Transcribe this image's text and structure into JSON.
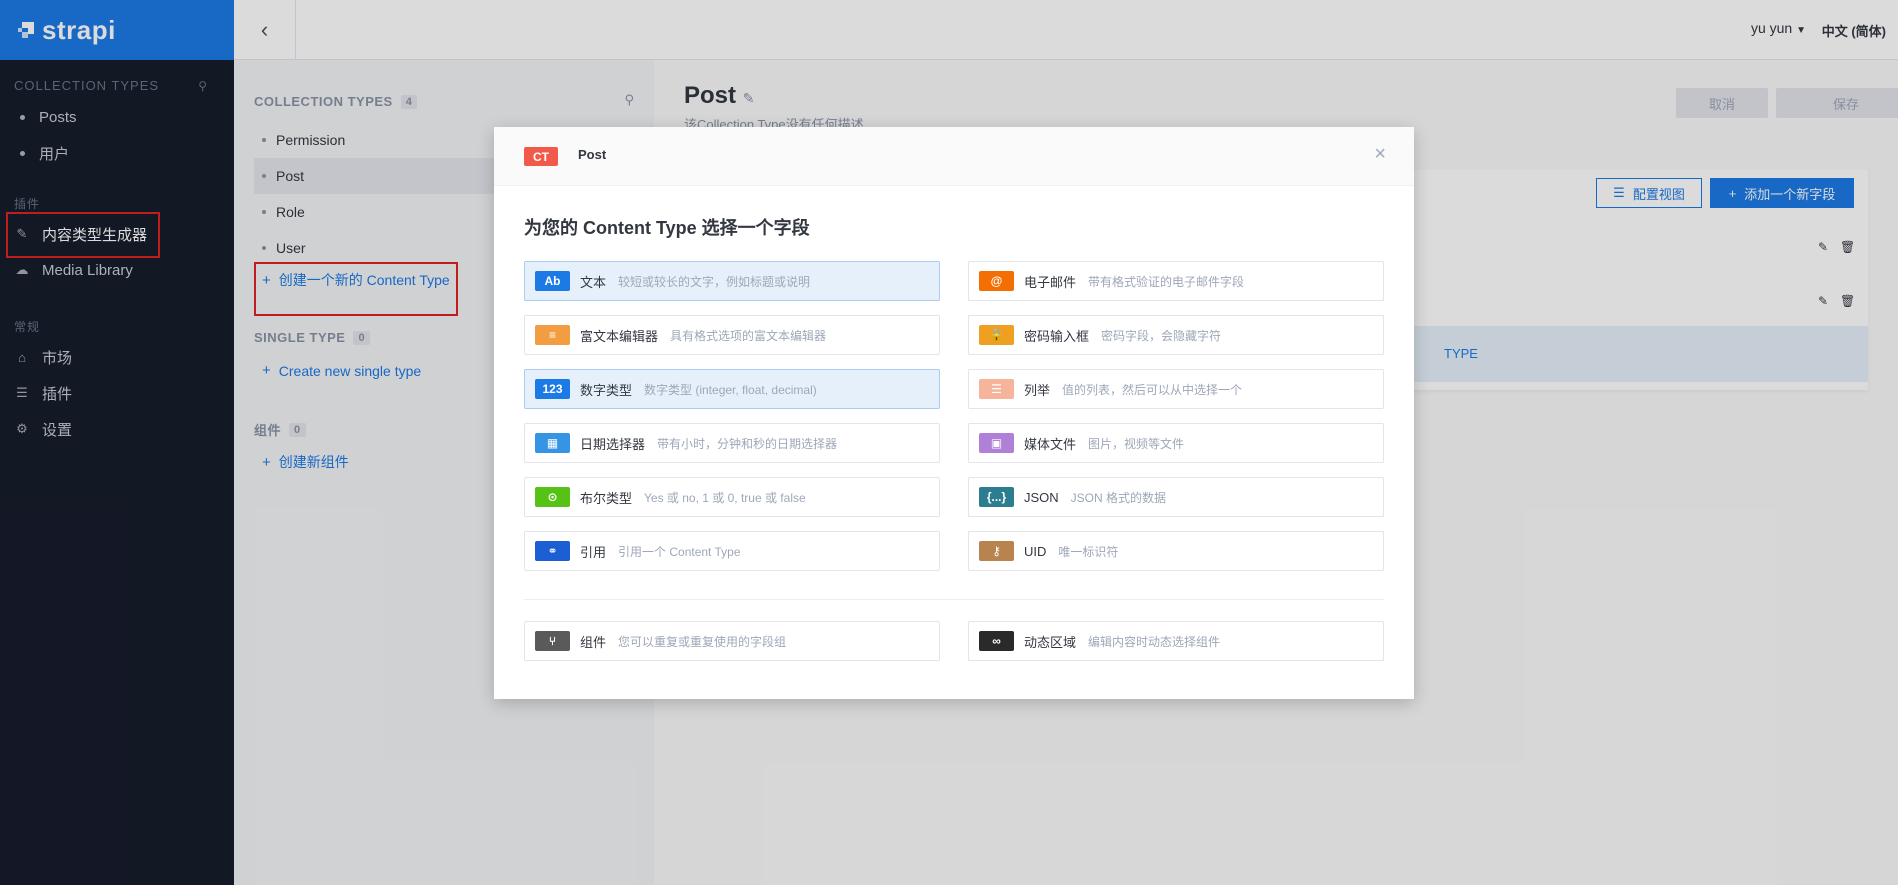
{
  "nav": {
    "brand": "strapi",
    "collection_types_label": "COLLECTION TYPES",
    "collection_items": [
      "Posts",
      "用户"
    ],
    "plugins_label": "插件",
    "plugin_items": [
      "内容类型生成器",
      "Media Library"
    ],
    "general_label": "常规",
    "general_items": [
      "市场",
      "插件",
      "设置"
    ]
  },
  "header": {
    "user": "yu yun",
    "language": "中文 (简体)"
  },
  "ct_list": {
    "collection_label": "COLLECTION TYPES",
    "collection_count": "4",
    "items": [
      "Permission",
      "Post",
      "Role",
      "User"
    ],
    "create_collection": "创建一个新的 Content Type",
    "single_label": "SINGLE TYPE",
    "single_count": "0",
    "create_single": "Create new single type",
    "components_label": "组件",
    "components_count": "0",
    "create_component": "创建新组件"
  },
  "editor": {
    "title": "Post",
    "subtitle": "该Collection Type没有任何描述",
    "cancel": "取消",
    "save": "保存",
    "configure_view": "配置视图",
    "add_field": "添加一个新字段",
    "stripe_text": "TYPE"
  },
  "modal": {
    "badge": "CT",
    "title": "Post",
    "question": "为您的 Content Type 选择一个字段",
    "fields": [
      {
        "icon": "Ab",
        "name": "文本",
        "desc": "较短或较长的文字，例如标题或说明",
        "color": "#1c7ae6"
      },
      {
        "icon": "@",
        "name": "电子邮件",
        "desc": "带有格式验证的电子邮件字段",
        "color": "#f36f04"
      },
      {
        "icon": "≡",
        "name": "富文本编辑器",
        "desc": "具有格式选项的富文本编辑器",
        "color": "#f29d41"
      },
      {
        "icon": "🔒",
        "name": "密码输入框",
        "desc": "密码字段，会隐藏字符",
        "color": "#f0a021"
      },
      {
        "icon": "123",
        "name": "数字类型",
        "desc": "数字类型 (integer, float, decimal)",
        "color": "#1c7ae6"
      },
      {
        "icon": "☰",
        "name": "列举",
        "desc": "值的列表，然后可以从中选择一个",
        "color": "#f6b59b"
      },
      {
        "icon": "▦",
        "name": "日期选择器",
        "desc": "带有小时，分钟和秒的日期选择器",
        "color": "#3594e3"
      },
      {
        "icon": "▣",
        "name": "媒体文件",
        "desc": "图片，视频等文件",
        "color": "#b07fd8"
      },
      {
        "icon": "⊙",
        "name": "布尔类型",
        "desc": "Yes 或 no, 1 或 0, true 或 false",
        "color": "#56c216"
      },
      {
        "icon": "{...}",
        "name": "JSON",
        "desc": "JSON 格式的数据",
        "color": "#2b7d8f"
      },
      {
        "icon": "⚭",
        "name": "引用",
        "desc": "引用一个 Content Type",
        "color": "#1c5fd4"
      },
      {
        "icon": "⚷",
        "name": "UID",
        "desc": "唯一标识符",
        "color": "#b8834f"
      },
      {
        "icon": "⑂",
        "name": "组件",
        "desc": "您可以重复或重复使用的字段组",
        "color": "#5a5a5a"
      },
      {
        "icon": "∞",
        "name": "动态区域",
        "desc": "编辑内容时动态选择组件",
        "color": "#2a2a2a"
      }
    ],
    "selected": [
      "文本",
      "数字类型"
    ]
  }
}
